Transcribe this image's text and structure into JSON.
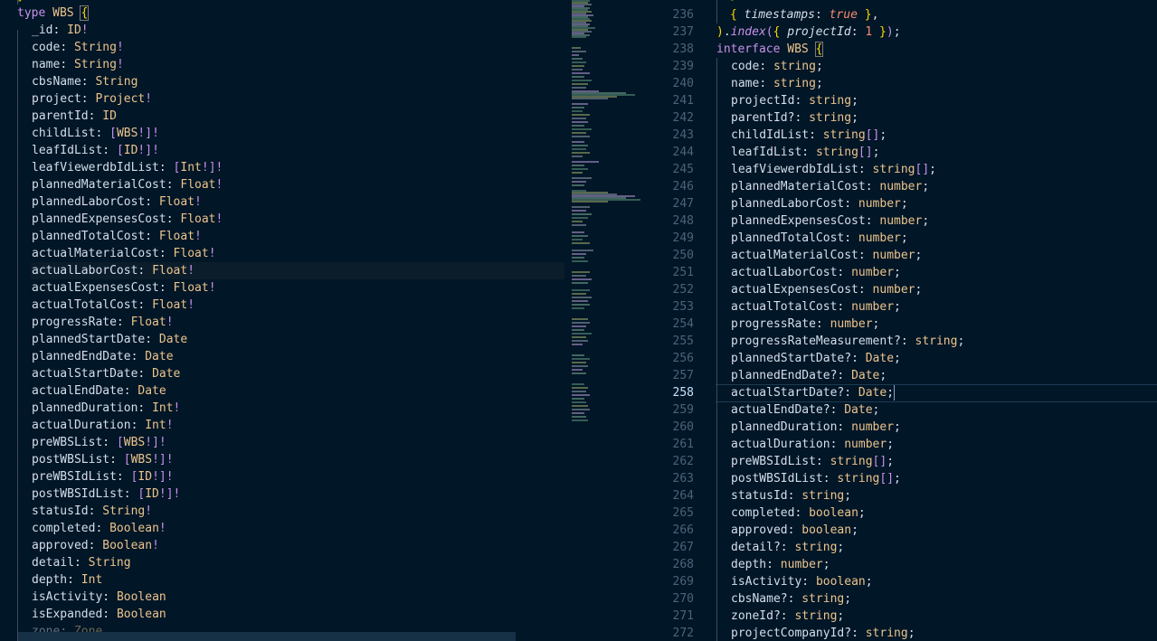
{
  "left_editor": {
    "top_line": "}",
    "type_keyword": "type",
    "type_name": "WBS",
    "open_brace": "{",
    "fields": [
      {
        "name": "_id",
        "type": "ID",
        "bang": "!",
        "list": false
      },
      {
        "name": "code",
        "type": "String",
        "bang": "!",
        "list": false
      },
      {
        "name": "name",
        "type": "String",
        "bang": "!",
        "list": false
      },
      {
        "name": "cbsName",
        "type": "String",
        "bang": "",
        "list": false
      },
      {
        "name": "project",
        "type": "Project",
        "bang": "!",
        "list": false
      },
      {
        "name": "parentId",
        "type": "ID",
        "bang": "",
        "list": false
      },
      {
        "name": "childList",
        "type": "WBS",
        "bang": "!",
        "list": true
      },
      {
        "name": "leafIdList",
        "type": "ID",
        "bang": "!",
        "list": true
      },
      {
        "name": "leafViewerdbIdList",
        "type": "Int",
        "bang": "!",
        "list": true
      },
      {
        "name": "plannedMaterialCost",
        "type": "Float",
        "bang": "!",
        "list": false
      },
      {
        "name": "plannedLaborCost",
        "type": "Float",
        "bang": "!",
        "list": false
      },
      {
        "name": "plannedExpensesCost",
        "type": "Float",
        "bang": "!",
        "list": false
      },
      {
        "name": "plannedTotalCost",
        "type": "Float",
        "bang": "!",
        "list": false
      },
      {
        "name": "actualMaterialCost",
        "type": "Float",
        "bang": "!",
        "list": false
      },
      {
        "name": "actualLaborCost",
        "type": "Float",
        "bang": "!",
        "list": false
      },
      {
        "name": "actualExpensesCost",
        "type": "Float",
        "bang": "!",
        "list": false
      },
      {
        "name": "actualTotalCost",
        "type": "Float",
        "bang": "!",
        "list": false
      },
      {
        "name": "progressRate",
        "type": "Float",
        "bang": "!",
        "list": false
      },
      {
        "name": "plannedStartDate",
        "type": "Date",
        "bang": "",
        "list": false
      },
      {
        "name": "plannedEndDate",
        "type": "Date",
        "bang": "",
        "list": false
      },
      {
        "name": "actualStartDate",
        "type": "Date",
        "bang": "",
        "list": false
      },
      {
        "name": "actualEndDate",
        "type": "Date",
        "bang": "",
        "list": false
      },
      {
        "name": "plannedDuration",
        "type": "Int",
        "bang": "!",
        "list": false
      },
      {
        "name": "actualDuration",
        "type": "Int",
        "bang": "!",
        "list": false
      },
      {
        "name": "preWBSList",
        "type": "WBS",
        "bang": "!",
        "list": true
      },
      {
        "name": "postWBSList",
        "type": "WBS",
        "bang": "!",
        "list": true
      },
      {
        "name": "preWBSIdList",
        "type": "ID",
        "bang": "!",
        "list": true
      },
      {
        "name": "postWBSIdList",
        "type": "ID",
        "bang": "!",
        "list": true
      },
      {
        "name": "statusId",
        "type": "String",
        "bang": "!",
        "list": false
      },
      {
        "name": "completed",
        "type": "Boolean",
        "bang": "!",
        "list": false
      },
      {
        "name": "approved",
        "type": "Boolean",
        "bang": "!",
        "list": false
      },
      {
        "name": "detail",
        "type": "String",
        "bang": "",
        "list": false
      },
      {
        "name": "depth",
        "type": "Int",
        "bang": "",
        "list": false
      },
      {
        "name": "isActivity",
        "type": "Boolean",
        "bang": "",
        "list": false
      },
      {
        "name": "isExpanded",
        "type": "Boolean",
        "bang": "",
        "list": false
      },
      {
        "name": "zone",
        "type": "Zone",
        "bang": "",
        "list": false
      }
    ]
  },
  "right_editor": {
    "active_line": 258,
    "pre_lines": [
      {
        "num": "236",
        "text": "{ timestamps: true },"
      },
      {
        "num": "237",
        "text": ").index({ projectId: 1 });"
      }
    ],
    "interface_line": {
      "num": "238",
      "keyword": "interface",
      "name": "WBS",
      "brace": "{"
    },
    "fields": [
      {
        "num": "239",
        "name": "code",
        "optional": "",
        "type": "string",
        "arr": ""
      },
      {
        "num": "240",
        "name": "name",
        "optional": "",
        "type": "string",
        "arr": ""
      },
      {
        "num": "241",
        "name": "projectId",
        "optional": "",
        "type": "string",
        "arr": ""
      },
      {
        "num": "242",
        "name": "parentId",
        "optional": "?",
        "type": "string",
        "arr": ""
      },
      {
        "num": "243",
        "name": "childIdList",
        "optional": "",
        "type": "string",
        "arr": "[]"
      },
      {
        "num": "244",
        "name": "leafIdList",
        "optional": "",
        "type": "string",
        "arr": "[]"
      },
      {
        "num": "245",
        "name": "leafViewerdbIdList",
        "optional": "",
        "type": "string",
        "arr": "[]"
      },
      {
        "num": "246",
        "name": "plannedMaterialCost",
        "optional": "",
        "type": "number",
        "arr": ""
      },
      {
        "num": "247",
        "name": "plannedLaborCost",
        "optional": "",
        "type": "number",
        "arr": ""
      },
      {
        "num": "248",
        "name": "plannedExpensesCost",
        "optional": "",
        "type": "number",
        "arr": ""
      },
      {
        "num": "249",
        "name": "plannedTotalCost",
        "optional": "",
        "type": "number",
        "arr": ""
      },
      {
        "num": "250",
        "name": "actualMaterialCost",
        "optional": "",
        "type": "number",
        "arr": ""
      },
      {
        "num": "251",
        "name": "actualLaborCost",
        "optional": "",
        "type": "number",
        "arr": ""
      },
      {
        "num": "252",
        "name": "actualExpensesCost",
        "optional": "",
        "type": "number",
        "arr": ""
      },
      {
        "num": "253",
        "name": "actualTotalCost",
        "optional": "",
        "type": "number",
        "arr": ""
      },
      {
        "num": "254",
        "name": "progressRate",
        "optional": "",
        "type": "number",
        "arr": ""
      },
      {
        "num": "255",
        "name": "progressRateMeasurement",
        "optional": "?",
        "type": "string",
        "arr": ""
      },
      {
        "num": "256",
        "name": "plannedStartDate",
        "optional": "?",
        "type": "Date",
        "arr": ""
      },
      {
        "num": "257",
        "name": "plannedEndDate",
        "optional": "?",
        "type": "Date",
        "arr": ""
      },
      {
        "num": "258",
        "name": "actualStartDate",
        "optional": "?",
        "type": "Date",
        "arr": ""
      },
      {
        "num": "259",
        "name": "actualEndDate",
        "optional": "?",
        "type": "Date",
        "arr": ""
      },
      {
        "num": "260",
        "name": "plannedDuration",
        "optional": "",
        "type": "number",
        "arr": ""
      },
      {
        "num": "261",
        "name": "actualDuration",
        "optional": "",
        "type": "number",
        "arr": ""
      },
      {
        "num": "262",
        "name": "preWBSIdList",
        "optional": "",
        "type": "string",
        "arr": "[]"
      },
      {
        "num": "263",
        "name": "postWBSIdList",
        "optional": "",
        "type": "string",
        "arr": "[]"
      },
      {
        "num": "264",
        "name": "statusId",
        "optional": "",
        "type": "string",
        "arr": ""
      },
      {
        "num": "265",
        "name": "completed",
        "optional": "",
        "type": "boolean",
        "arr": ""
      },
      {
        "num": "266",
        "name": "approved",
        "optional": "",
        "type": "boolean",
        "arr": ""
      },
      {
        "num": "267",
        "name": "detail",
        "optional": "?",
        "type": "string",
        "arr": ""
      },
      {
        "num": "268",
        "name": "depth",
        "optional": "",
        "type": "number",
        "arr": ""
      },
      {
        "num": "269",
        "name": "isActivity",
        "optional": "",
        "type": "boolean",
        "arr": ""
      },
      {
        "num": "270",
        "name": "cbsName",
        "optional": "?",
        "type": "string",
        "arr": ""
      },
      {
        "num": "271",
        "name": "zoneId",
        "optional": "?",
        "type": "string",
        "arr": ""
      },
      {
        "num": "272",
        "name": "projectCompanyId",
        "optional": "?",
        "type": "string",
        "arr": ""
      }
    ]
  },
  "colors": {
    "background": "#011627",
    "text": "#d6deeb",
    "type": "#ecc48d",
    "keyword": "#c792ea",
    "number": "#f78c6c",
    "line_number": "#4b6479",
    "active_line_number": "#c5e4fd"
  }
}
